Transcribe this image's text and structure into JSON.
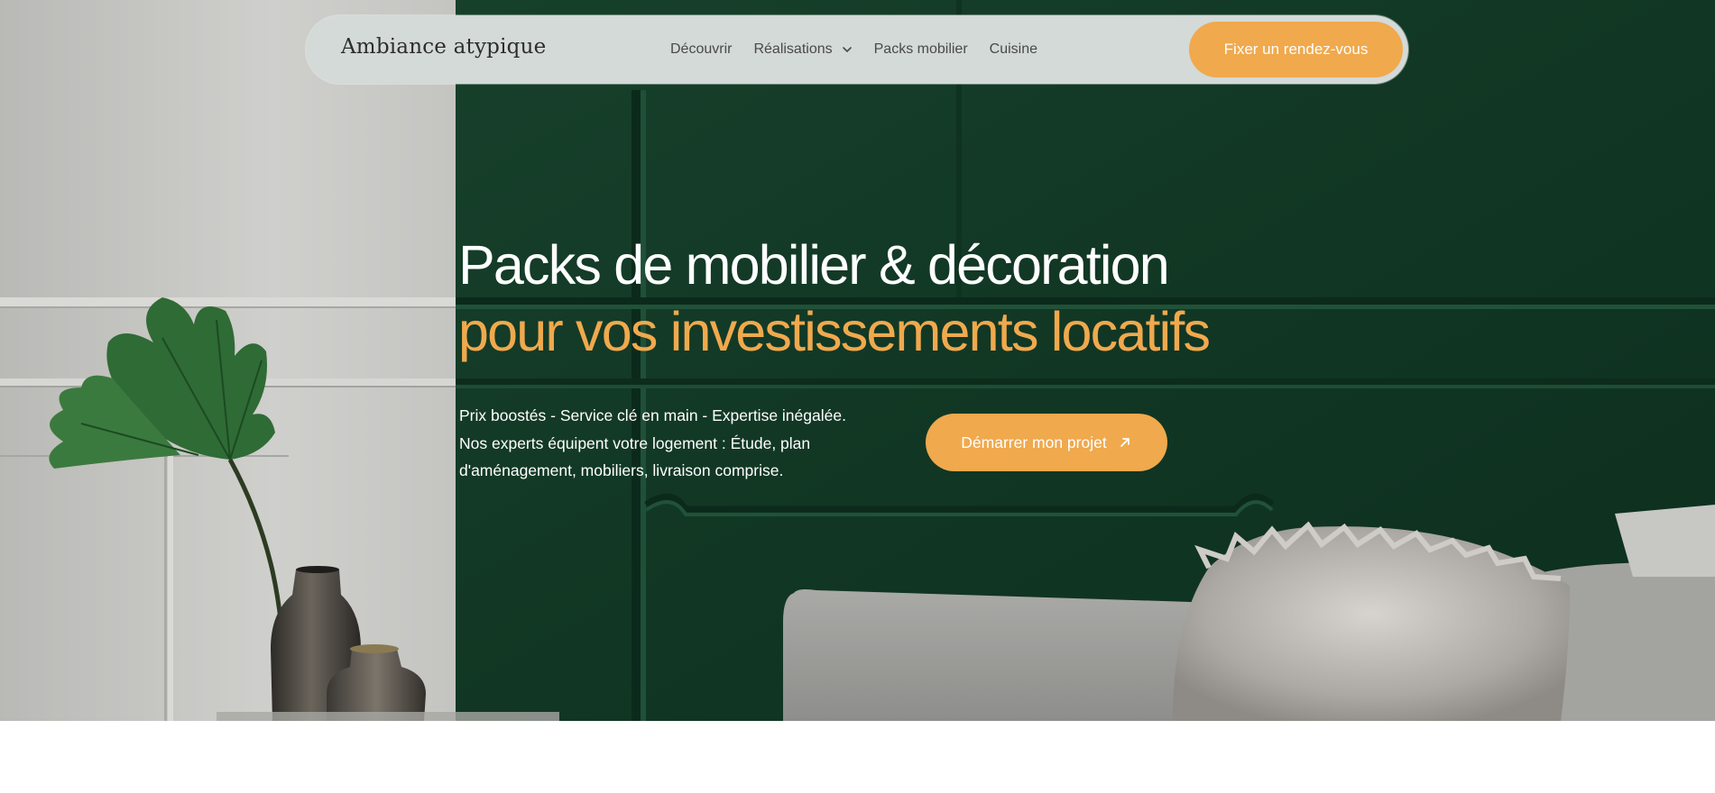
{
  "brand": {
    "name": "Ambiance atypique"
  },
  "nav": {
    "items": [
      {
        "label": "Découvrir",
        "has_dropdown": false
      },
      {
        "label": "Réalisations",
        "has_dropdown": true
      },
      {
        "label": "Packs mobilier",
        "has_dropdown": false
      },
      {
        "label": "Cuisine",
        "has_dropdown": false
      }
    ],
    "cta_label": "Fixer un rendez-vous"
  },
  "hero": {
    "title_line1": "Packs de mobilier & décoration",
    "title_line2": "pour vos investissements locatifs",
    "sub_lines": [
      "Prix boostés - Service clé en main - Expertise inégalée.",
      "Nos experts équipent votre logement : Étude, plan",
      "d'aménagement, mobiliers, livraison comprise."
    ],
    "cta_label": "Démarrer mon projet",
    "cta_icon": "arrow-up-right-icon"
  },
  "colors": {
    "accent": "#f0a94d",
    "wall_green": "#123a26",
    "navbar_bg": "#d3dad8",
    "wall_grey": "#c9c9c6"
  }
}
